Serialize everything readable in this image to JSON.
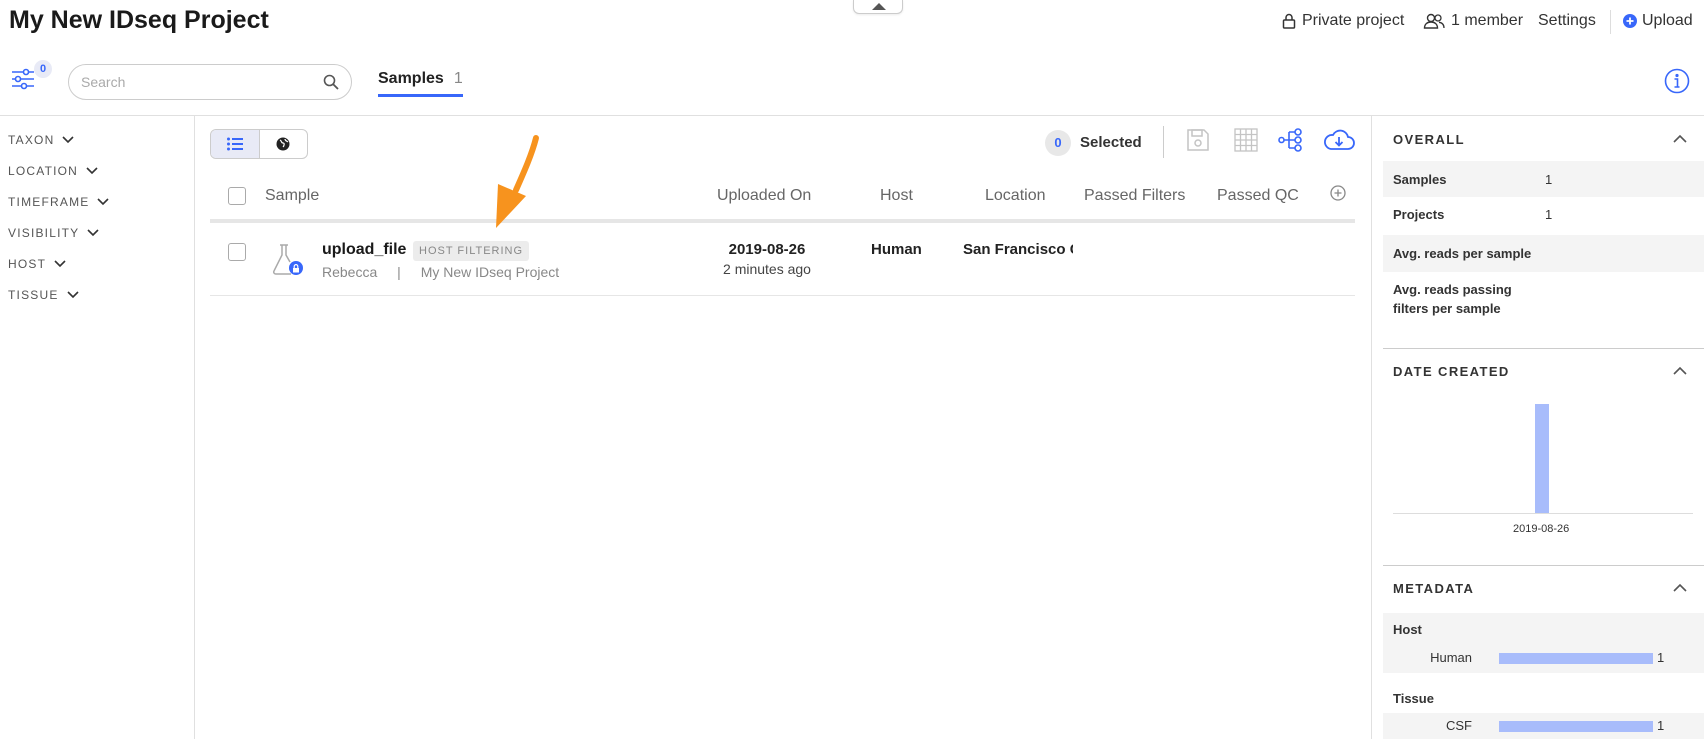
{
  "header": {
    "title": "My New IDseq Project",
    "privacy": "Private project",
    "members": "1 member",
    "settings": "Settings",
    "upload": "Upload"
  },
  "toolbar": {
    "filter_count": "0",
    "search_placeholder": "Search",
    "tab_label": "Samples",
    "tab_count": "1"
  },
  "filters": [
    {
      "label": "TAXON"
    },
    {
      "label": "LOCATION"
    },
    {
      "label": "TIMEFRAME"
    },
    {
      "label": "VISIBILITY"
    },
    {
      "label": "HOST"
    },
    {
      "label": "TISSUE"
    }
  ],
  "selection": {
    "count": "0",
    "label": "Selected"
  },
  "table": {
    "columns": [
      "Sample",
      "Uploaded On",
      "Host",
      "Location",
      "Passed Filters",
      "Passed QC"
    ],
    "rows": [
      {
        "name": "upload_file",
        "status": "HOST FILTERING",
        "user": "Rebecca",
        "separator": "|",
        "project": "My New IDseq Project",
        "date": "2019-08-26",
        "age": "2 minutes ago",
        "host": "Human",
        "location": "San Francisco C"
      }
    ]
  },
  "stats": {
    "overall_title": "OVERALL",
    "rows": [
      {
        "label": "Samples",
        "value": "1"
      },
      {
        "label": "Projects",
        "value": "1"
      },
      {
        "label": "Avg. reads per sample",
        "value": ""
      },
      {
        "label": "Avg. reads passing",
        "label2": "filters per sample",
        "value": ""
      }
    ],
    "date_title": "DATE CREATED",
    "metadata_title": "METADATA",
    "metadata": [
      {
        "field": "Host",
        "label": "Human",
        "count": "1"
      },
      {
        "field": "Tissue",
        "label": "CSF",
        "count": "1"
      }
    ]
  },
  "chart_data": {
    "type": "bar",
    "categories": [
      "2019-08-26"
    ],
    "values": [
      1
    ]
  },
  "colors": {
    "accent": "#3867fa",
    "bar": "#a8bcfb",
    "arrow": "#f7931e"
  }
}
